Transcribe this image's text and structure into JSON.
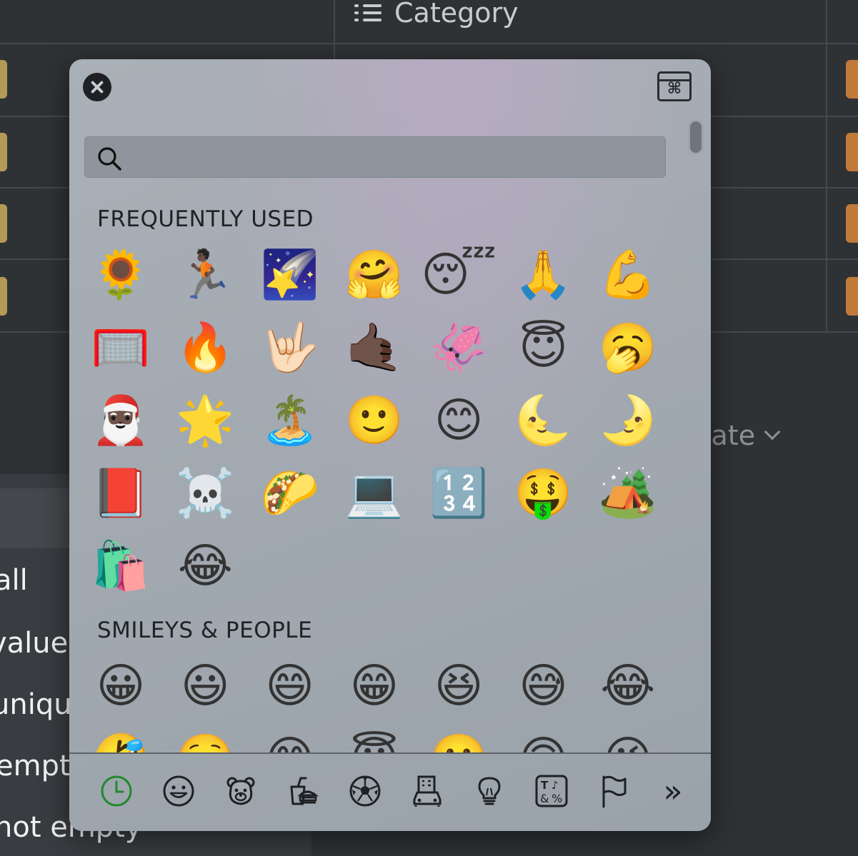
{
  "background": {
    "column_header": "Category",
    "calculate_label": "culate",
    "menu_items": [
      "all",
      "values",
      "unique",
      "empty",
      "not empty"
    ]
  },
  "picker": {
    "search": {
      "placeholder": "",
      "value": ""
    },
    "sections": [
      {
        "title": "FREQUENTLY USED",
        "emojis": [
          "🌻",
          "🏃🏿",
          "🌠",
          "🤗",
          "😴",
          "🙏",
          "💪",
          "🥅",
          "🔥",
          "🤟🏻",
          "🤙🏿",
          "🦑",
          "😇",
          "🥱",
          "🎅🏿",
          "🌟",
          "🏝️",
          "🙂",
          "😊",
          "🌜",
          "🌛",
          "📕",
          "☠️",
          "🌮",
          "💻",
          "🔢",
          "🤑",
          "🏕️",
          "🛍️",
          "😂"
        ]
      },
      {
        "title": "SMILEYS & PEOPLE",
        "emojis": [
          "😀",
          "😃",
          "😄",
          "😁",
          "😆",
          "😅",
          "😂",
          "🤣",
          "☺️",
          "😊",
          "😇",
          "🙂",
          "🙃",
          "😉"
        ]
      }
    ],
    "categories": [
      {
        "name": "frequently-used",
        "icon": "clock-icon",
        "active": true
      },
      {
        "name": "smileys-people",
        "icon": "smiley-icon"
      },
      {
        "name": "animals-nature",
        "icon": "bear-icon"
      },
      {
        "name": "food-drink",
        "icon": "food-icon"
      },
      {
        "name": "activity",
        "icon": "soccer-ball-icon"
      },
      {
        "name": "travel-places",
        "icon": "building-car-icon"
      },
      {
        "name": "objects",
        "icon": "lightbulb-icon"
      },
      {
        "name": "symbols",
        "icon": "symbols-icon"
      },
      {
        "name": "flags",
        "icon": "flag-icon"
      }
    ],
    "more_label": "»",
    "accent_color": "#1f8a2e"
  }
}
